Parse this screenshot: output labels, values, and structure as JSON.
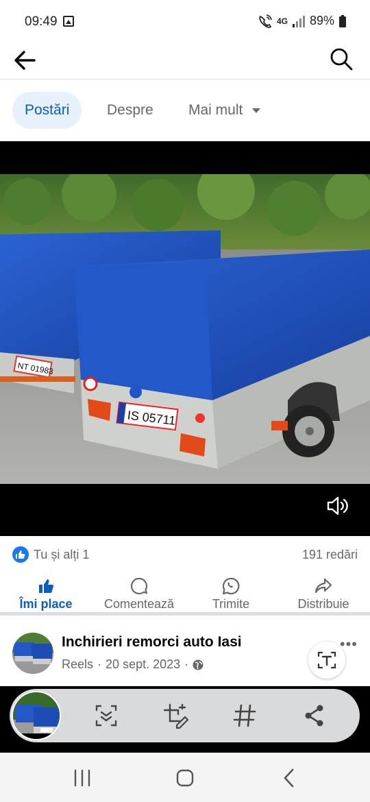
{
  "status_bar": {
    "time": "09:49",
    "network": "4G",
    "battery": "89%"
  },
  "top_bar": {
    "back_icon": "arrow-left-icon",
    "search_icon": "search-icon"
  },
  "tabs": [
    {
      "label": "Postări",
      "active": true
    },
    {
      "label": "Despre",
      "active": false
    },
    {
      "label": "Mai mult",
      "active": false
    }
  ],
  "video": {
    "plate_1": "IS 05711",
    "plate_2": "NT 01983",
    "sound_icon": "speaker-icon"
  },
  "reactions": {
    "text": "Tu și alți 1",
    "views": "191 redări"
  },
  "actions": {
    "like": "Îmi place",
    "comment": "Comentează",
    "send": "Trimite",
    "share": "Distribuie"
  },
  "post": {
    "page_name": "Inchirieri remorci auto Iasi",
    "source": "Reels",
    "separator": "·",
    "date": "20 sept. 2023"
  },
  "colors": {
    "accent": "#0a5dc2",
    "like_blue": "#1877f2",
    "tarp_blue": "#1f55c6",
    "secondary_text": "#65676b"
  }
}
